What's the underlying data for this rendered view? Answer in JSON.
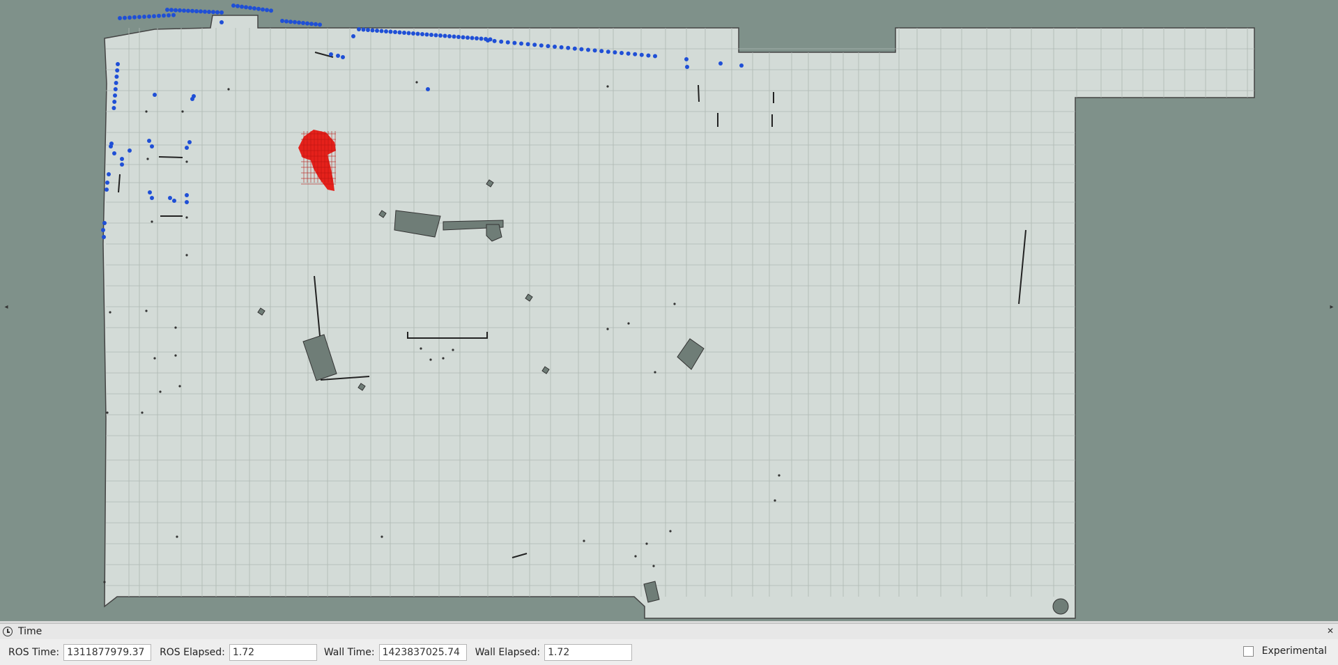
{
  "panel": {
    "title": "Time",
    "close_icon": "close-icon",
    "clock_icon": "clock-icon"
  },
  "fields": {
    "ros_time_label": "ROS Time:",
    "ros_time_value": "1311877979.37",
    "ros_elapsed_label": "ROS Elapsed:",
    "ros_elapsed_value": "1.72",
    "wall_time_label": "Wall Time:",
    "wall_time_value": "1423837025.74",
    "wall_elapsed_label": "Wall Elapsed:",
    "wall_elapsed_value": "1.72",
    "experimental_label": "Experimental",
    "experimental_checked": false
  },
  "colors": {
    "background": "#7f918a",
    "free_space": "#d3dbd7",
    "obstacle": "#6f7d77",
    "laser_scan": "#1f4fd6",
    "particle_cloud": "#e5211b"
  }
}
